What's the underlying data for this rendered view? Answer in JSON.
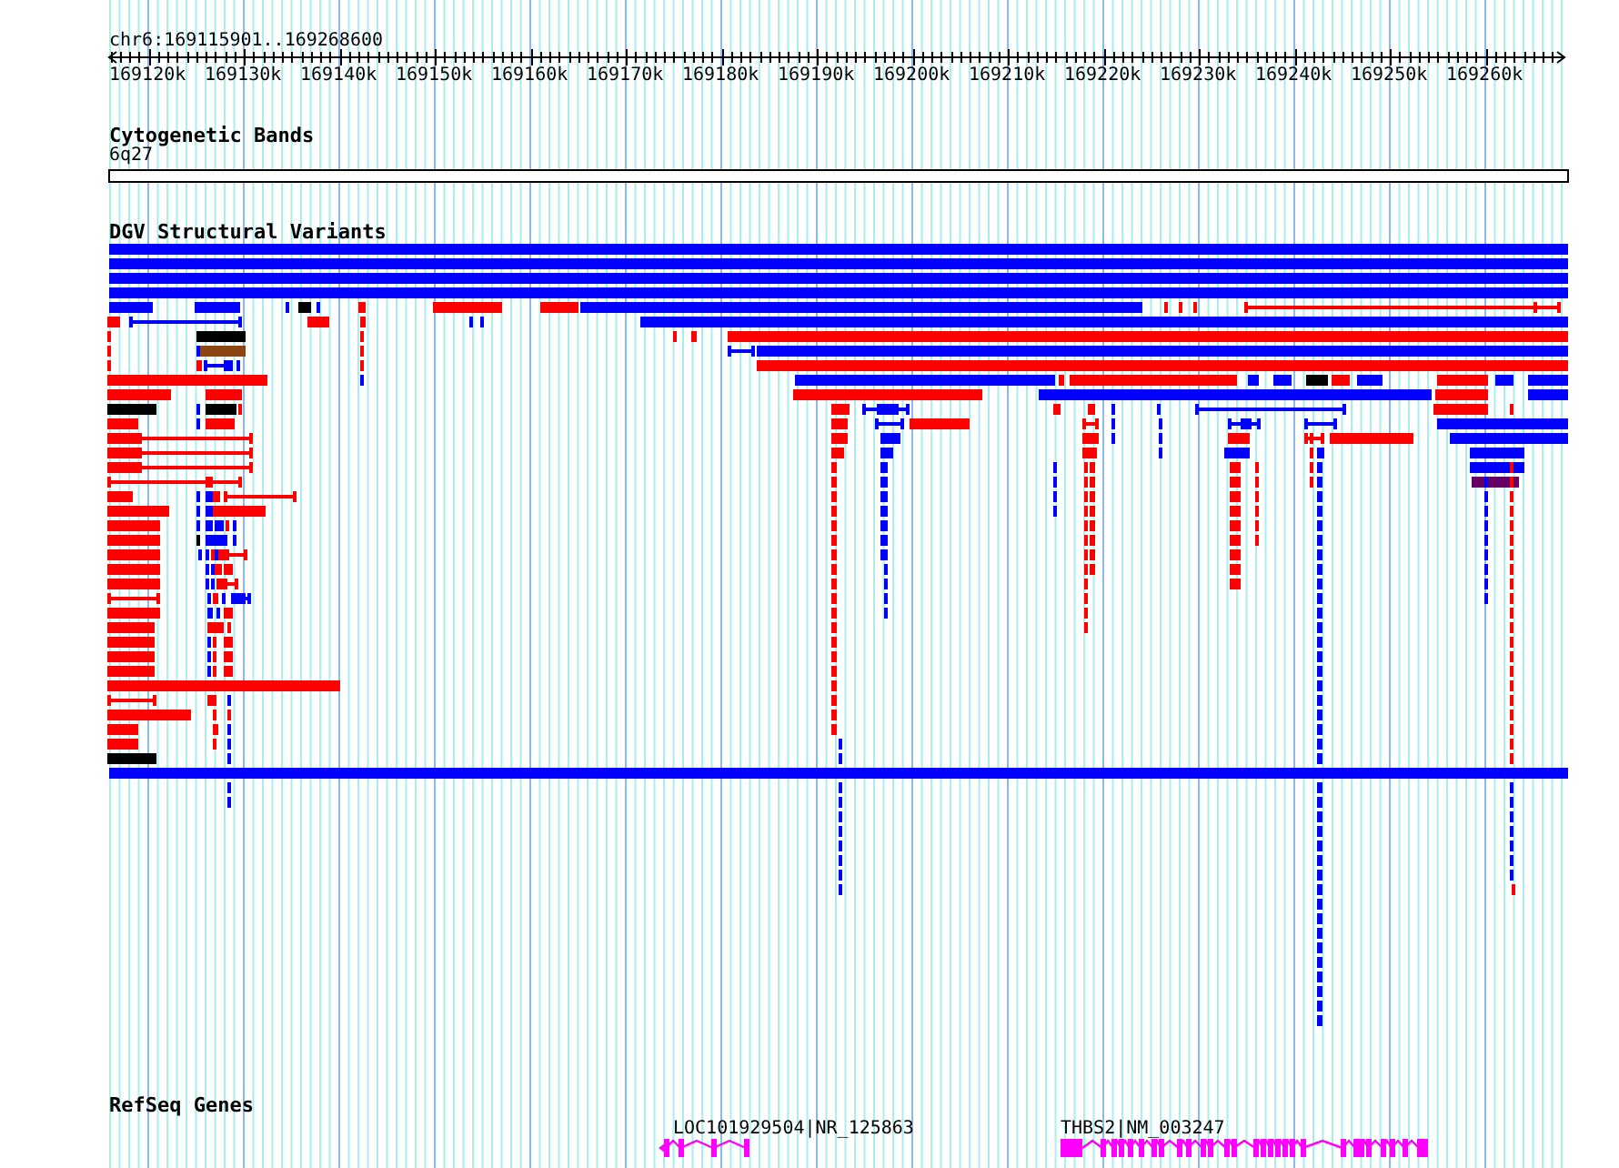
{
  "location": "chr6:169115901..169268600",
  "ruler": {
    "ticks": [
      "169120k",
      "169130k",
      "169140k",
      "169150k",
      "169160k",
      "169170k",
      "169180k",
      "169190k",
      "169200k",
      "169210k",
      "169220k",
      "169230k",
      "169240k",
      "169250k",
      "169260k"
    ]
  },
  "tracks": [
    {
      "kind": "cytoband",
      "title": "Cytogenetic Bands",
      "band": "6q27"
    },
    {
      "kind": "variants",
      "title": "DGV Structural Variants"
    },
    {
      "kind": "genes",
      "title": "RefSeq Genes",
      "genes": [
        {
          "label": "LOC101929504|NR_125863"
        },
        {
          "label": "THBS2|NM_003247"
        }
      ]
    }
  ]
}
